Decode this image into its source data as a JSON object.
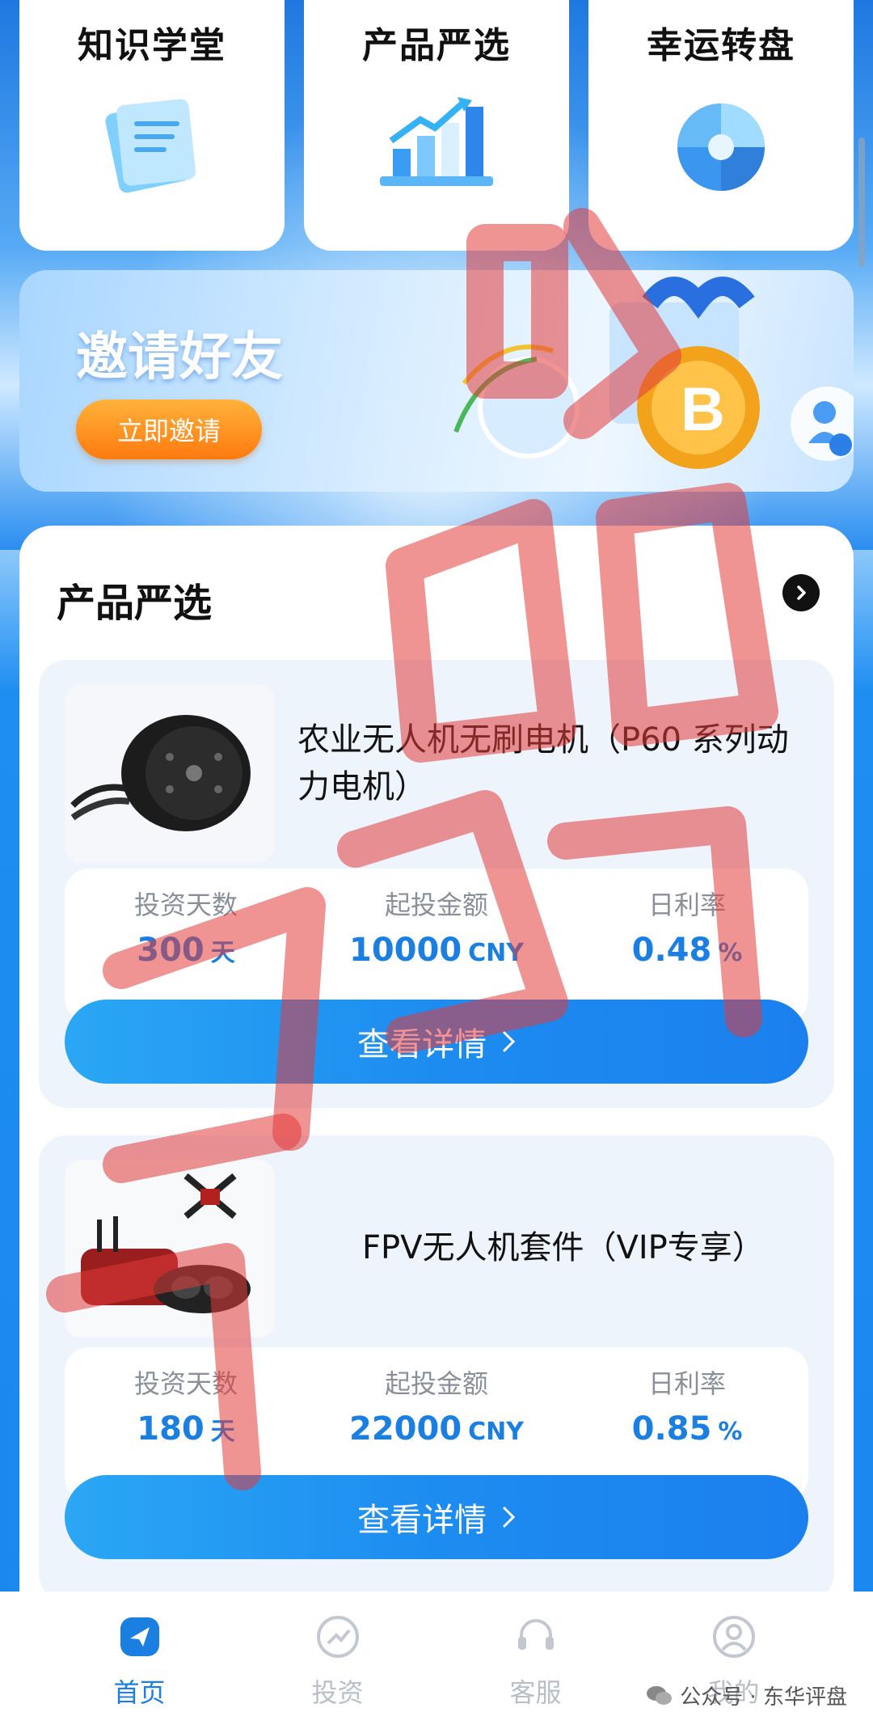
{
  "quick_tiles": [
    {
      "label": "知识学堂",
      "icon": "document-icon"
    },
    {
      "label": "产品严选",
      "icon": "bar-chart-icon"
    },
    {
      "label": "幸运转盘",
      "icon": "wheel-icon"
    }
  ],
  "invite": {
    "title": "邀请好友",
    "button_label": "立即邀请"
  },
  "products_section": {
    "title": "产品严选",
    "items": [
      {
        "name": "农业无人机无刷电机（P60 系列动力电机）",
        "stats": [
          {
            "label": "投资天数",
            "value": "300",
            "unit": "天"
          },
          {
            "label": "起投金额",
            "value": "10000",
            "unit": "CNY"
          },
          {
            "label": "日利率",
            "value": "0.48",
            "unit": "%"
          }
        ],
        "button_label": "查看详情",
        "image": "motor-photo"
      },
      {
        "name": "FPV无人机套件（VIP专享）",
        "stats": [
          {
            "label": "投资天数",
            "value": "180",
            "unit": "天"
          },
          {
            "label": "起投金额",
            "value": "22000",
            "unit": "CNY"
          },
          {
            "label": "日利率",
            "value": "0.85",
            "unit": "%"
          }
        ],
        "button_label": "查看详情",
        "image": "drone-kit-photo"
      }
    ]
  },
  "tabbar": [
    {
      "label": "首页",
      "active": true,
      "icon": "home-icon"
    },
    {
      "label": "投资",
      "active": false,
      "icon": "invest-icon"
    },
    {
      "label": "客服",
      "active": false,
      "icon": "headset-icon"
    },
    {
      "label": "我的",
      "active": false,
      "icon": "profile-icon"
    }
  ],
  "footer_credit": "公众号 · 东华评盘",
  "colors": {
    "accent": "#1a7fe0",
    "button_gradient_start": "#2aa7f5",
    "invite_button": "#ff8c1a",
    "watermark": "#e23b3b"
  }
}
